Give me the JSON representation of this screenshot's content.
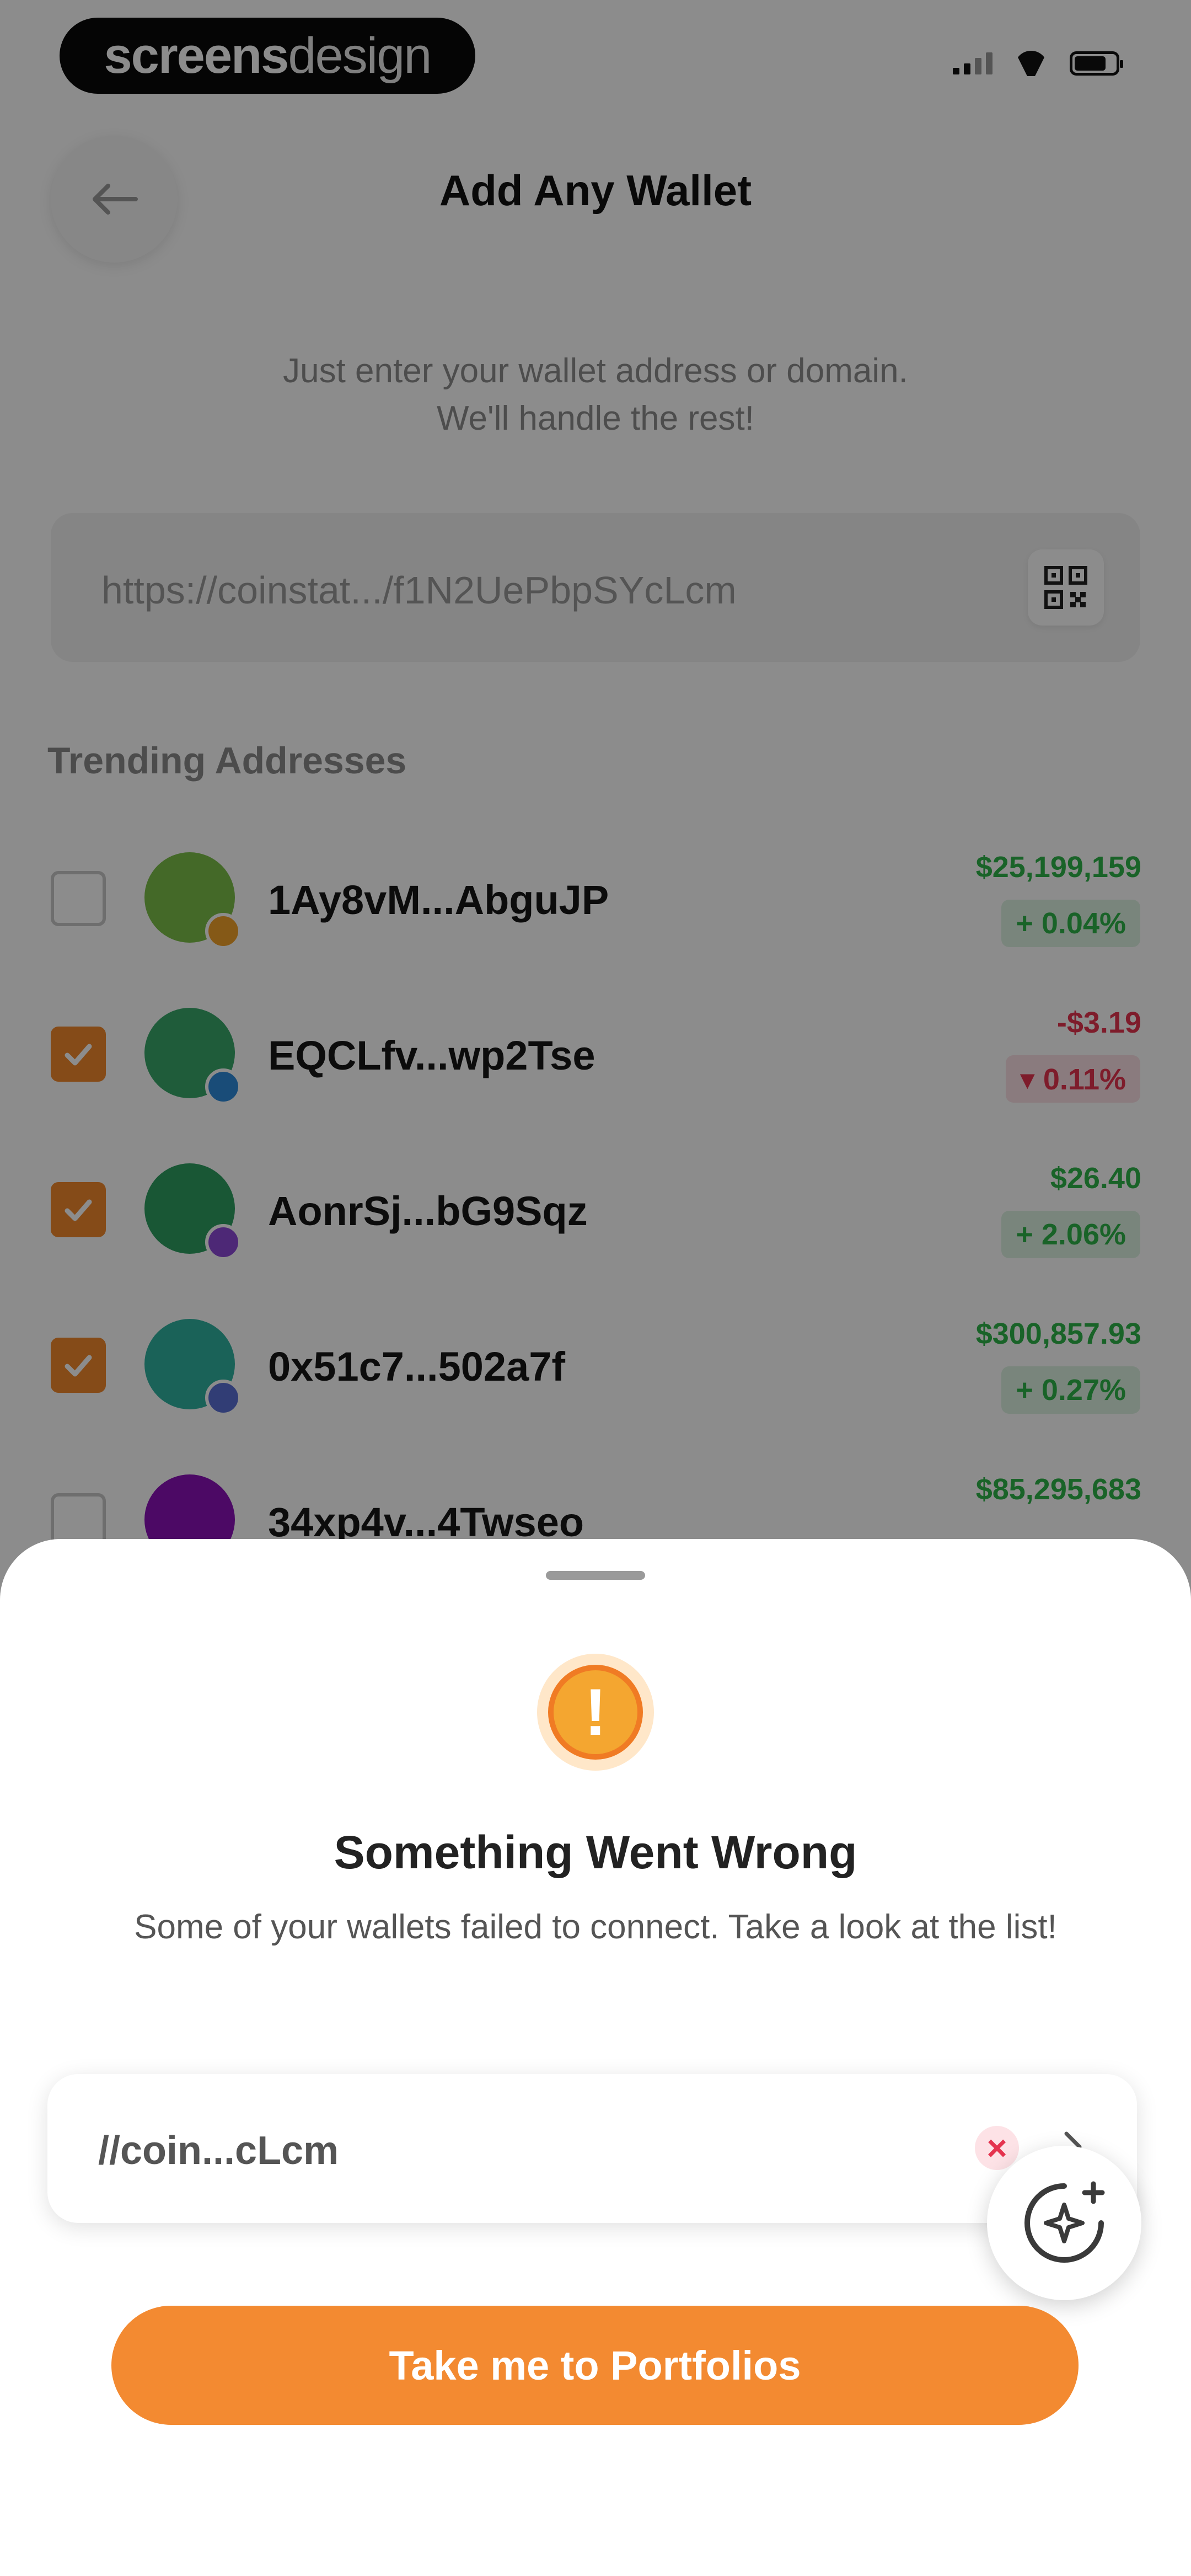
{
  "status_bar": {
    "brand_part1": "screens",
    "brand_part2": "design"
  },
  "header": {
    "title": "Add Any Wallet",
    "back_icon": "back-arrow-icon"
  },
  "intro": {
    "line1": "Just enter your wallet address or domain.",
    "line2": "We'll handle the rest!"
  },
  "address_input": {
    "value": "https://coinstat.../f1N2UePbpSYcLcm",
    "icon": "qr-code-icon"
  },
  "trending": {
    "title": "Trending Addresses",
    "items": [
      {
        "name": "1Ay8vM...AbguJP",
        "value": "$25,199,159",
        "change": "+ 0.04%",
        "checked": false,
        "trend": "up",
        "avatar_color": "#7cbf4a",
        "badge_color": "#f3a32b"
      },
      {
        "name": "EQCLfv...wp2Tse",
        "value": "-$3.19",
        "change": "▾ 0.11%",
        "checked": true,
        "trend": "down",
        "avatar_color": "#3aa86b",
        "badge_color": "#2f8bdb"
      },
      {
        "name": "AonrSj...bG9Sqz",
        "value": "$26.40",
        "change": "+ 2.06%",
        "checked": true,
        "trend": "up",
        "avatar_color": "#2e9e62",
        "badge_color": "#8d4ad8"
      },
      {
        "name": "0x51c7...502a7f",
        "value": "$300,857.93",
        "change": "+ 0.27%",
        "checked": true,
        "trend": "up",
        "avatar_color": "#31b3a0",
        "badge_color": "#5a6fd6"
      },
      {
        "name": "34xp4v...4Twseo",
        "value": "$85,295,683",
        "change": "",
        "checked": false,
        "trend": "up",
        "avatar_color": "#8a12b8",
        "badge_color": "#8a12b8"
      }
    ]
  },
  "sheet": {
    "icon": "warning-icon",
    "icon_glyph": "!",
    "title": "Something Went Wrong",
    "message": "Some of your wallets failed to connect. Take a look at the list!",
    "failed_item": {
      "label": "//coin...cLcm",
      "error_glyph": "×",
      "error_icon": "error-x-icon",
      "chevron_icon": "chevron-right-icon"
    },
    "fab_icon": "sparkle-add-icon",
    "primary_button": "Take me to Portfolios"
  }
}
